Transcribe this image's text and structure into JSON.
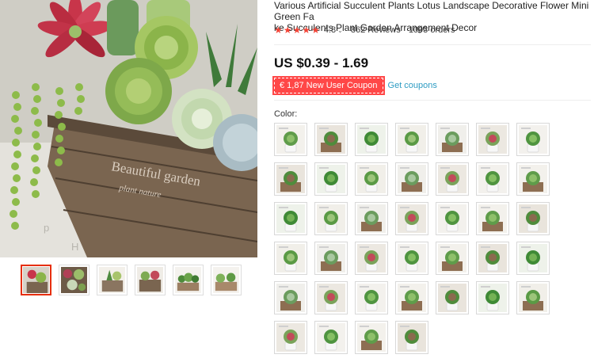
{
  "product": {
    "title": "Various Artificial Succulent Plants Lotus Landscape Decorative Flower Mini Green Fa\nke Succulents Plant Garden Arrangement Decor",
    "rating": "4.8",
    "reviews": "862 Reviews",
    "orders": "1093 orders",
    "price": "US $0.39 - 1.69",
    "coupon": "€ 1,87 New User Coupon",
    "get_coupons": "Get coupons",
    "color_label": "Color:"
  },
  "colors": {
    "accent": "#ff4747",
    "star": "#f44336",
    "link": "#2e9cc3",
    "thumb_active_border": "#e62e04"
  },
  "main_image": {
    "watermark_letters": [
      "p",
      "H"
    ],
    "box_text_1": "Beautiful garden",
    "box_text_2": "plant nature"
  },
  "thumbnails": [
    {
      "name": "thumb-1",
      "active": true
    },
    {
      "name": "thumb-2",
      "active": false
    },
    {
      "name": "thumb-3",
      "active": false
    },
    {
      "name": "thumb-4",
      "active": false
    },
    {
      "name": "thumb-5",
      "active": false
    },
    {
      "name": "thumb-6",
      "active": false
    }
  ],
  "swatch_rows": [
    [
      "white-pot-plant",
      "box-rosette",
      "green-cluster",
      "potted-spiky",
      "gray-rosette",
      "pink-rosette",
      "round-rosette"
    ],
    [
      "pink-pot-plant",
      "white-pot-spiky",
      "spiky-grass",
      "aloe-cluster",
      "agave-star",
      "white-pot-rosette",
      "green-flower"
    ],
    [
      "big-rosette",
      "star-rosette",
      "small-leaf",
      "tiny-succulent",
      "cactus-trio",
      "tall-echeveria",
      "star-grass"
    ],
    [
      "round-leaves",
      "green-lotus",
      "dense-rosette",
      "moss-box",
      "large-lotus",
      "coin-leaf",
      "jade-sprig"
    ],
    [
      "aloe-fan",
      "tall-grass",
      "ball-cluster",
      "spiky-aloe",
      "barrel-cactus",
      "tree-succulent",
      "clustered-buds"
    ],
    [
      "yellow-flower",
      "green-burst",
      "pink-pot-stem",
      "tall-plant-pink"
    ]
  ]
}
